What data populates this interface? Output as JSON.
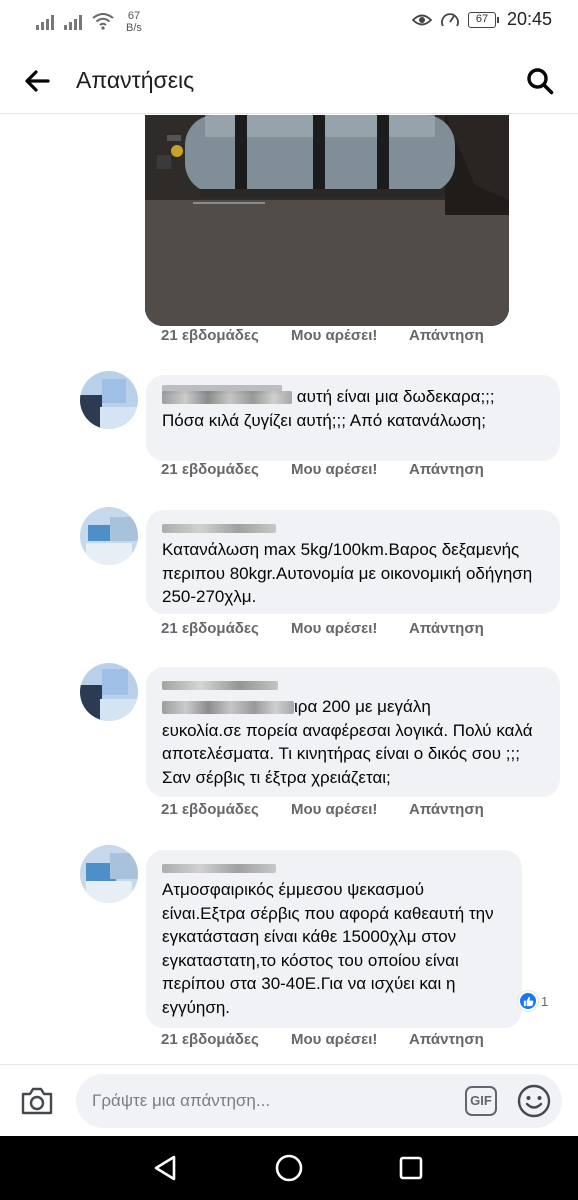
{
  "status_bar": {
    "net_speed_value": "67",
    "net_speed_unit": "B/s",
    "battery": "67",
    "time": "20:45",
    "icons": [
      "signal-icon",
      "signal-icon",
      "wifi-icon",
      "eye-icon",
      "gauge-icon",
      "battery-icon"
    ]
  },
  "header": {
    "title": "Απαντήσεις",
    "back_icon": "arrow-left-icon",
    "search_icon": "search-icon"
  },
  "photo": {
    "meta": {
      "time": "21 εβδομάδες",
      "like": "Μου αρέσει!",
      "reply": "Απάντηση"
    }
  },
  "comments": [
    {
      "text_visible": "αυτή είναι μια δωδεκαρα;;;\nΠόσα κιλά ζυγίζει αυτή;;; Από κατανάλωση;",
      "meta": {
        "time": "21 εβδομάδες",
        "like": "Μου αρέσει!",
        "reply": "Απάντηση"
      }
    },
    {
      "text": "Κατανάλωση max 5kg/100km.Βαρος δεξαμενής περιπου 80kgr.Αυτονομία με οικονομική οδήγηση 250-270χλμ.",
      "meta": {
        "time": "21 εβδομάδες",
        "like": "Μου αρέσει!",
        "reply": "Απάντηση"
      }
    },
    {
      "text_visible": "ιρα 200 με μεγάλη\nευκολία.σε πορεία αναφέρεσαι λογικά. Πολύ καλά αποτελέσματα. Τι κινητήρας είναι ο δικός σου ;;; Σαν σέρβις τι έξτρα χρειάζεται;",
      "meta": {
        "time": "21 εβδομάδες",
        "like": "Μου αρέσει!",
        "reply": "Απάντηση"
      }
    },
    {
      "text": "Ατμοσφαιρικός έμμεσου ψεκασμού είναι.Εξτρα σέρβις που αφορά καθεαυτή την εγκατάσταση είναι κάθε 15000χλμ στον εγκαταστατη,το κόστος του οποίου είναι περίπου στα 30-40Ε.Για να ισχύει και η εγγύηση.",
      "reaction_count": "1",
      "reaction_icon": "thumbs-up-icon",
      "meta": {
        "time": "21 εβδομάδες",
        "like": "Μου αρέσει!",
        "reply": "Απάντηση"
      }
    }
  ],
  "composer": {
    "placeholder": "Γράψτε μια απάντηση...",
    "gif_label": "GIF",
    "icons": [
      "camera-icon",
      "gif-icon",
      "emoji-icon"
    ]
  },
  "nav": {
    "icons": [
      "back-triangle-icon",
      "home-circle-icon",
      "recents-square-icon"
    ]
  },
  "colors": {
    "bubble": "#f0f2f5",
    "meta_text": "#65676b",
    "like_blue": "#1877f2",
    "nav_bg": "#000000"
  }
}
